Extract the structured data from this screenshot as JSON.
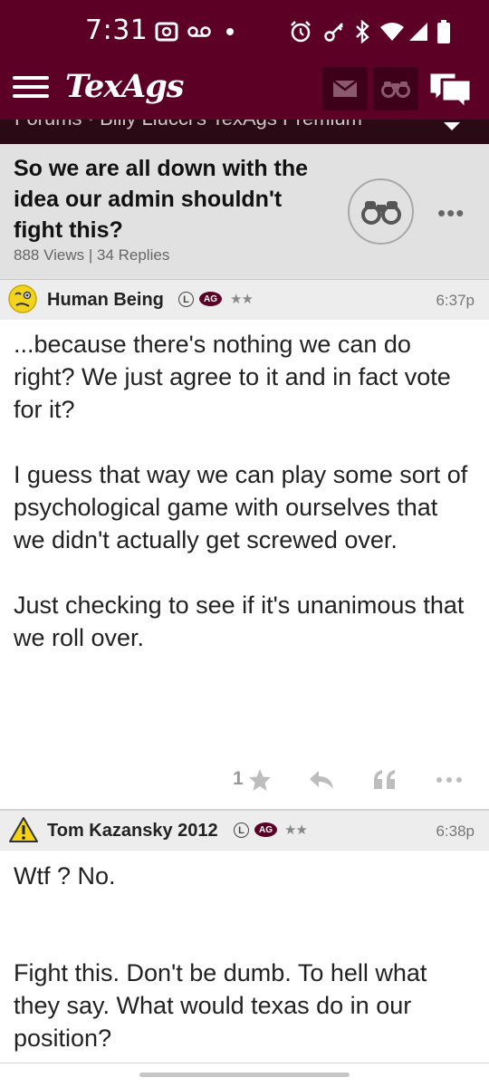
{
  "status_bar": {
    "time": "7:31",
    "icons": [
      "signal-box-icon",
      "voicemail-icon",
      "dot-icon",
      "alarm-icon",
      "key-icon",
      "bluetooth-icon",
      "wifi-icon",
      "cell-signal-icon",
      "battery-icon"
    ]
  },
  "app_bar": {
    "logo": "TexAgs",
    "icons": [
      "hamburger-menu-icon",
      "mail-icon",
      "binoculars-icon",
      "chat-bubbles-icon"
    ]
  },
  "breadcrumb": {
    "text": "Forums · Billy Liucci's TexAgs Premium"
  },
  "thread": {
    "title": "So we are all down with the idea our admin shouldn't fight this?",
    "meta": "888 Views | 34 Replies"
  },
  "posts": [
    {
      "username": "Human Being",
      "badge_l": "L",
      "badge_ag": "AG",
      "stars": "★★",
      "time": "6:37p",
      "paragraphs": [
        "...because there's nothing we can do right? We just agree to it and in fact vote for it?",
        "I guess that way we can play some sort of psychological game with ourselves that we didn't actually get screwed over.",
        "Just checking to see if it's unanimous that we roll over."
      ],
      "likes": "1"
    },
    {
      "username": "Tom Kazansky 2012",
      "badge_l": "L",
      "badge_ag": "AG",
      "stars": "★★",
      "time": "6:38p",
      "paragraphs": [
        "Wtf ? No.",
        "Fight this. Don't be dumb. To hell what they say. What would texas do in our position?"
      ]
    }
  ],
  "colors": {
    "brand_maroon": "#5c0025",
    "header_gray": "#e1e1e1",
    "post_header_gray": "#ededed"
  }
}
